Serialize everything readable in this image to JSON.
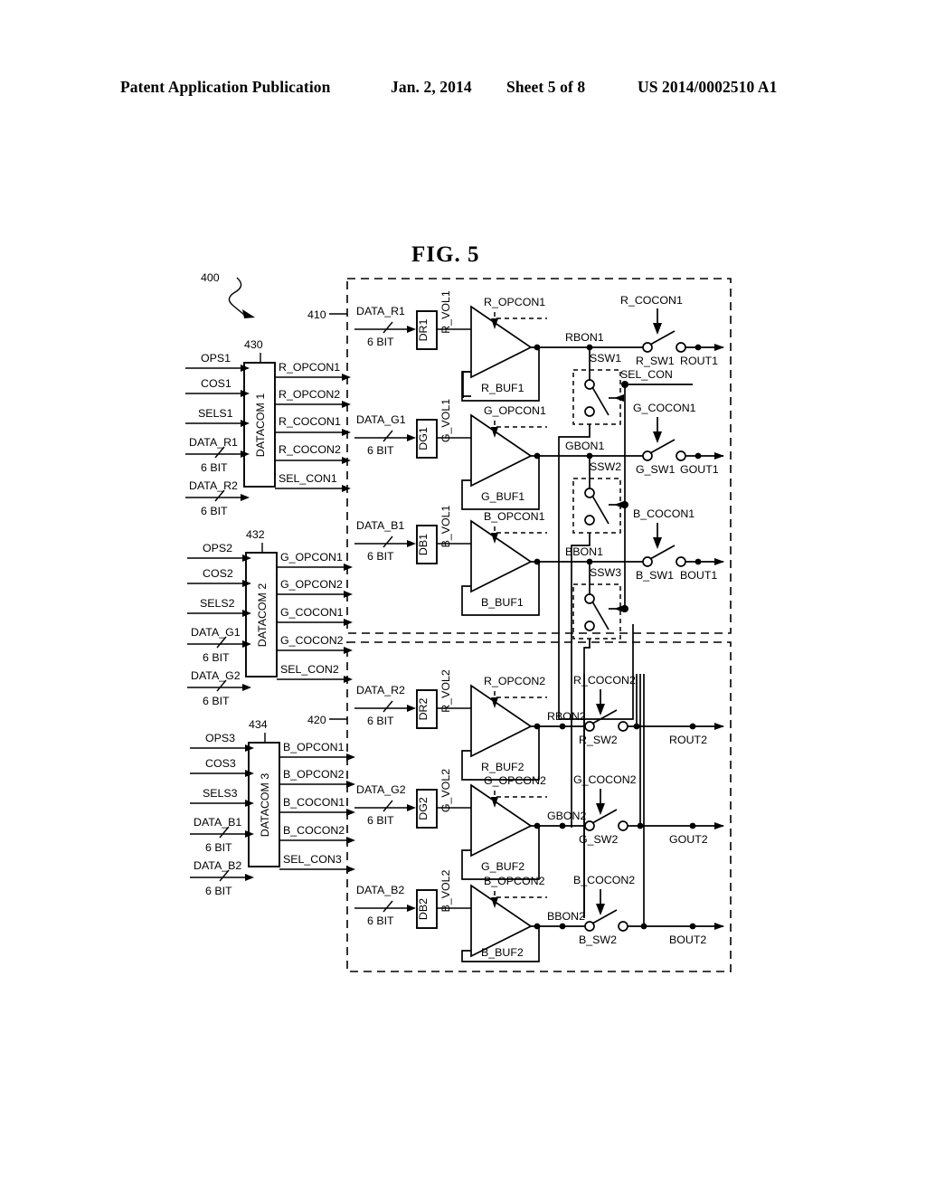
{
  "header": {
    "publication": "Patent Application Publication",
    "date": "Jan. 2, 2014",
    "sheet": "Sheet 5 of 8",
    "doc_number": "US 2014/0002510 A1"
  },
  "figure": {
    "title": "FIG.  5",
    "refs": {
      "whole": "400",
      "block_410": "410",
      "block_420": "420",
      "datacom1": "430",
      "datacom2": "432",
      "datacom3": "434"
    }
  },
  "datacom": [
    {
      "ref": "430",
      "name": "DATACOM 1",
      "inputs": [
        "OPS1",
        "COS1",
        "SELS1",
        "DATA_R1",
        "DATA_R2"
      ],
      "bit_labels": [
        "6 BIT",
        "6 BIT"
      ],
      "outputs": [
        "R_OPCON1",
        "R_OPCON2",
        "R_COCON1",
        "R_COCON2",
        "SEL_CON1"
      ]
    },
    {
      "ref": "432",
      "name": "DATACOM 2",
      "inputs": [
        "OPS2",
        "COS2",
        "SELS2",
        "DATA_G1",
        "DATA_G2"
      ],
      "bit_labels": [
        "6 BIT",
        "6 BIT"
      ],
      "outputs": [
        "G_OPCON1",
        "G_OPCON2",
        "G_COCON1",
        "G_COCON2",
        "SEL_CON2"
      ]
    },
    {
      "ref": "434",
      "name": "DATACOM 3",
      "inputs": [
        "OPS3",
        "COS3",
        "SELS3",
        "DATA_B1",
        "DATA_B2"
      ],
      "bit_labels": [
        "6 BIT",
        "6 BIT"
      ],
      "outputs": [
        "B_OPCON1",
        "B_OPCON2",
        "B_COCON1",
        "B_COCON2",
        "SEL_CON3"
      ]
    }
  ],
  "channel1": {
    "ref": "410",
    "rows": [
      {
        "data_label": "DATA_R1",
        "bit": "6 BIT",
        "dac": "DR1",
        "vol": "R_VOL1",
        "opcon": "R_OPCON1",
        "buf": "R_BUF1",
        "bon": "RBON1",
        "cocon": "R_COCON1",
        "sw": "R_SW1",
        "out": "ROUT1",
        "ssw": "SSW1"
      },
      {
        "data_label": "DATA_G1",
        "bit": "6 BIT",
        "dac": "DG1",
        "vol": "G_VOL1",
        "opcon": "G_OPCON1",
        "buf": "G_BUF1",
        "bon": "GBON1",
        "cocon": "G_COCON1",
        "sw": "G_SW1",
        "out": "GOUT1",
        "ssw": "SSW2"
      },
      {
        "data_label": "DATA_B1",
        "bit": "6 BIT",
        "dac": "DB1",
        "vol": "B_VOL1",
        "opcon": "B_OPCON1",
        "buf": "B_BUF1",
        "bon": "BBON1",
        "cocon": "B_COCON1",
        "sw": "B_SW1",
        "out": "BOUT1",
        "ssw": "SSW3"
      }
    ],
    "sel_con": "SEL_CON"
  },
  "channel2": {
    "ref": "420",
    "rows": [
      {
        "data_label": "DATA_R2",
        "bit": "6 BIT",
        "dac": "DR2",
        "vol": "R_VOL2",
        "opcon": "R_OPCON2",
        "buf": "R_BUF2",
        "bon": "RBON2",
        "cocon": "R_COCON2",
        "sw": "R_SW2",
        "out": "ROUT2"
      },
      {
        "data_label": "DATA_G2",
        "bit": "6 BIT",
        "dac": "DG2",
        "vol": "G_VOL2",
        "opcon": "G_OPCON2",
        "buf": "G_BUF2",
        "bon": "GBON2",
        "cocon": "G_COCON2",
        "sw": "G_SW2",
        "out": "GOUT2"
      },
      {
        "data_label": "DATA_B2",
        "bit": "6 BIT",
        "dac": "DB2",
        "vol": "B_VOL2",
        "opcon": "B_OPCON2",
        "buf": "B_BUF2",
        "bon": "BBON2",
        "cocon": "B_COCON2",
        "sw": "B_SW2",
        "out": "BOUT2"
      }
    ]
  }
}
